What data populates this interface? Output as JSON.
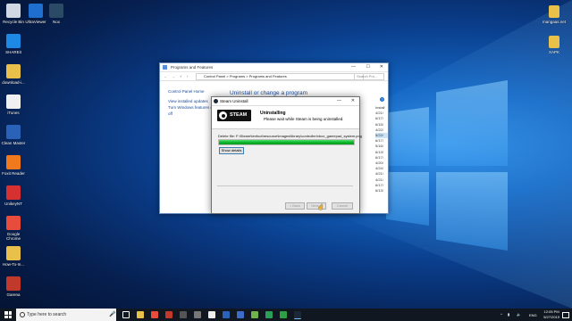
{
  "desktop_icons_left": [
    {
      "label": "Recycle Bin",
      "color": "#cfd8e3"
    },
    {
      "label": "SHAREit",
      "color": "#1e88e5"
    },
    {
      "label": "download-i...",
      "color": "#e8c04a"
    },
    {
      "label": "iTunes",
      "color": "#f0f0f0"
    },
    {
      "label": "Clean Master",
      "color": "#2a62b8"
    },
    {
      "label": "Foxit Reader",
      "color": "#f07a1b"
    },
    {
      "label": "UnikeyNT",
      "color": "#d63031"
    },
    {
      "label": "Google Chrome",
      "color": "#e74c3c"
    },
    {
      "label": "How-To-In...",
      "color": "#e8c04a"
    },
    {
      "label": "Garena",
      "color": "#c0392b"
    }
  ],
  "desktop_icons_top": [
    {
      "label": "UltraViewer",
      "color": "#1f6fd1"
    },
    {
      "label": "Nox",
      "color": "#2b4a66"
    }
  ],
  "desktop_icons_right": [
    {
      "label": "mangaas.net",
      "color": "#e8c04a"
    },
    {
      "label": "XAPK",
      "color": "#e8c04a"
    }
  ],
  "programs_window": {
    "title": "Programs and Features",
    "breadcrumb": [
      "Control Panel",
      "Programs",
      "Programs and Features"
    ],
    "search_placeholder": "Search Pro...",
    "left_links": [
      "Control Panel Home",
      "View installed updates",
      "Turn Windows features on or off"
    ],
    "heading": "Uninstall or change a program",
    "column_header": "Install",
    "dates": [
      "4/21/",
      "6/17/",
      "6/15/",
      "4/22/",
      "5/22/",
      "6/17/",
      "5/16/",
      "6/13/",
      "6/17/",
      "4/20/",
      "4/24/",
      "4/21/",
      "4/21/",
      "6/17/",
      "6/13/"
    ]
  },
  "steam_dialog": {
    "title": "Steam Uninstall",
    "logo_text": "STEAM",
    "heading": "Uninstalling",
    "subheading": "Please wait while Steam is being uninstalled.",
    "delete_file": "Delete file: F:\\Steam\\tenfoot\\resource\\images\\library\\controller\\xbox_gamepad_system.png",
    "progress": 1.0,
    "show_details": "Show details",
    "back": "< Back",
    "next": "Next >",
    "cancel": "Cancel"
  },
  "taskbar": {
    "search_text": "Type here to search",
    "lang": "ENG",
    "time": "12:05 PM",
    "date": "5/27/2019"
  }
}
